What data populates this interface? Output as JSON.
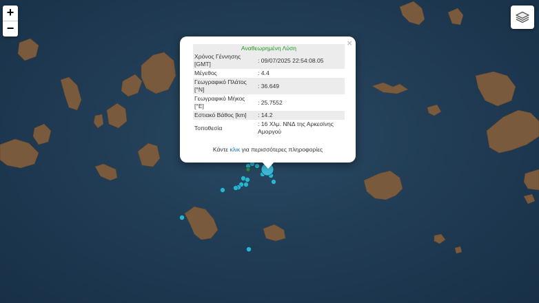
{
  "zoom": {
    "in_label": "+",
    "out_label": "−"
  },
  "popup": {
    "header": "Αναθεωρημένη Λύση",
    "close_label": "×",
    "rows": [
      {
        "label": "Χρόνος Γέννησης [GMT]",
        "value": ": 09/07/2025 22:54:08.05"
      },
      {
        "label": "Μέγεθος",
        "value": ": 4.4"
      },
      {
        "label": "Γεωγραφικό Πλάτος [°N]",
        "value": ": 36.649"
      },
      {
        "label": "Γεωγραφικό Μήκος [°E]",
        "value": ": 25.7552"
      },
      {
        "label": "Εστιακό Βάθος [km]",
        "value": ": 14.2"
      },
      {
        "label": "Τοποθεσία",
        "value": ": 16 Χλμ. ΝΝΔ της Αρκεσίνης Αμοργού"
      }
    ],
    "more_prefix": "Κάντε ",
    "more_link": "κλικ",
    "more_suffix": " για περισσότερες πληροφορίες"
  },
  "colors": {
    "sea": "#1f3a52",
    "land": "#7a5a3d",
    "quake_marker": "#2bb3cf",
    "main_quake": "#3fb8d6",
    "older_quake": "#2e8b57",
    "header_text": "#1e9a1e",
    "link": "#1a78b0"
  },
  "icons": {
    "layers": "layers-icon"
  }
}
